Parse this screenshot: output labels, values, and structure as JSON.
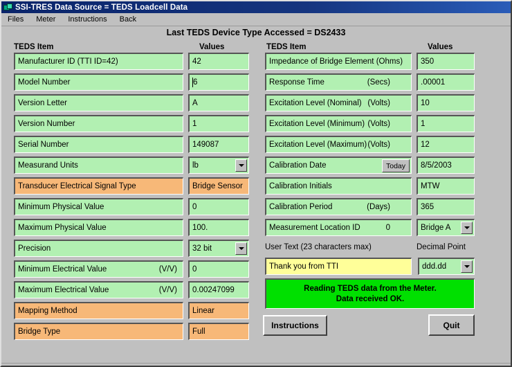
{
  "window": {
    "title": "SSI-TRES  Data Source = TEDS Loadcell Data",
    "icon": "app-window-icon"
  },
  "menu": {
    "items": [
      "Files",
      "Meter",
      "Instructions",
      "Back"
    ]
  },
  "banner": {
    "text": "Last TEDS Device Type Accessed = DS2433"
  },
  "columns": {
    "left_item_header": "TEDS Item",
    "left_value_header": "Values",
    "right_item_header": "TEDS Item",
    "right_value_header": "Values"
  },
  "left_rows": [
    {
      "label": "Manufacturer ID   (TTI  ID=42)",
      "unit": "",
      "value": "42",
      "style": "green",
      "value_type": "text"
    },
    {
      "label": "Model Number",
      "unit": "",
      "value": "6",
      "style": "green",
      "value_type": "text-caret"
    },
    {
      "label": "Version Letter",
      "unit": "",
      "value": "A",
      "style": "green",
      "value_type": "text"
    },
    {
      "label": "Version Number",
      "unit": "",
      "value": "1",
      "style": "green",
      "value_type": "text"
    },
    {
      "label": "Serial Number",
      "unit": "",
      "value": "149087",
      "style": "green",
      "value_type": "text"
    },
    {
      "label": "Measurand Units",
      "unit": "",
      "value": "lb",
      "style": "green",
      "value_type": "combo"
    },
    {
      "label": "Transducer Electrical Signal Type",
      "unit": "",
      "value": "Bridge Sensor",
      "style": "orange",
      "value_type": "text"
    },
    {
      "label": "Minimum Physical Value",
      "unit": "",
      "value": "0",
      "style": "green",
      "value_type": "text"
    },
    {
      "label": "Maximum Physical Value",
      "unit": "",
      "value": "100.",
      "style": "green",
      "value_type": "text"
    },
    {
      "label": "Precision",
      "unit": "",
      "value": "32 bit",
      "style": "green",
      "value_type": "combo"
    },
    {
      "label": "Minimum Electrical Value",
      "unit": "(V/V)",
      "value": "0",
      "style": "green",
      "value_type": "text"
    },
    {
      "label": "Maximum Electrical Value",
      "unit": "(V/V)",
      "value": "0.00247099",
      "style": "green",
      "value_type": "text"
    },
    {
      "label": "Mapping Method",
      "unit": "",
      "value": "Linear",
      "style": "orange",
      "value_type": "text"
    },
    {
      "label": "Bridge Type",
      "unit": "",
      "value": "Full",
      "style": "orange",
      "value_type": "text"
    }
  ],
  "right_rows": [
    {
      "label": "Impedance of Bridge Element (Ohms)",
      "unit": "",
      "value": "350",
      "style": "green",
      "value_type": "text"
    },
    {
      "label": "Response Time",
      "unit": "(Secs)",
      "value": ".00001",
      "style": "green",
      "value_type": "text"
    },
    {
      "label": "Excitation Level (Nominal)",
      "unit": "(Volts)",
      "value": "10",
      "style": "green",
      "value_type": "text"
    },
    {
      "label": "Excitation Level (Minimum)",
      "unit": "(Volts)",
      "value": "1",
      "style": "green",
      "value_type": "text"
    },
    {
      "label": "Excitation Level (Maximum)",
      "unit": "(Volts)",
      "value": "12",
      "style": "green",
      "value_type": "text"
    },
    {
      "label": "Calibration Date",
      "unit": "",
      "value": "8/5/2003",
      "style": "green",
      "value_type": "text",
      "button": "Today"
    },
    {
      "label": "Calibration Initials",
      "unit": "",
      "value": "MTW",
      "style": "green",
      "value_type": "text"
    },
    {
      "label": "Calibration Period",
      "unit": "(Days)",
      "value": "365",
      "style": "green",
      "value_type": "text"
    },
    {
      "label": "Measurement Location ID",
      "unit": "0",
      "value": "Bridge A",
      "style": "green",
      "value_type": "combo"
    }
  ],
  "user_text": {
    "label": "User Text (23 characters max)",
    "value": "Thank you from TTI"
  },
  "decimal_point": {
    "label": "Decimal Point",
    "value": "ddd.dd"
  },
  "status": {
    "line1": "Reading TEDS data from the Meter.",
    "line2": "Data received OK."
  },
  "buttons": {
    "instructions": "Instructions",
    "quit": "Quit"
  },
  "colors": {
    "field_green": "#b2f0b2",
    "field_orange": "#f7b878",
    "field_yellow": "#ffff99",
    "status_green": "#00e000",
    "window_gray": "#c0c0c0",
    "title_blue": "#0a246a"
  }
}
